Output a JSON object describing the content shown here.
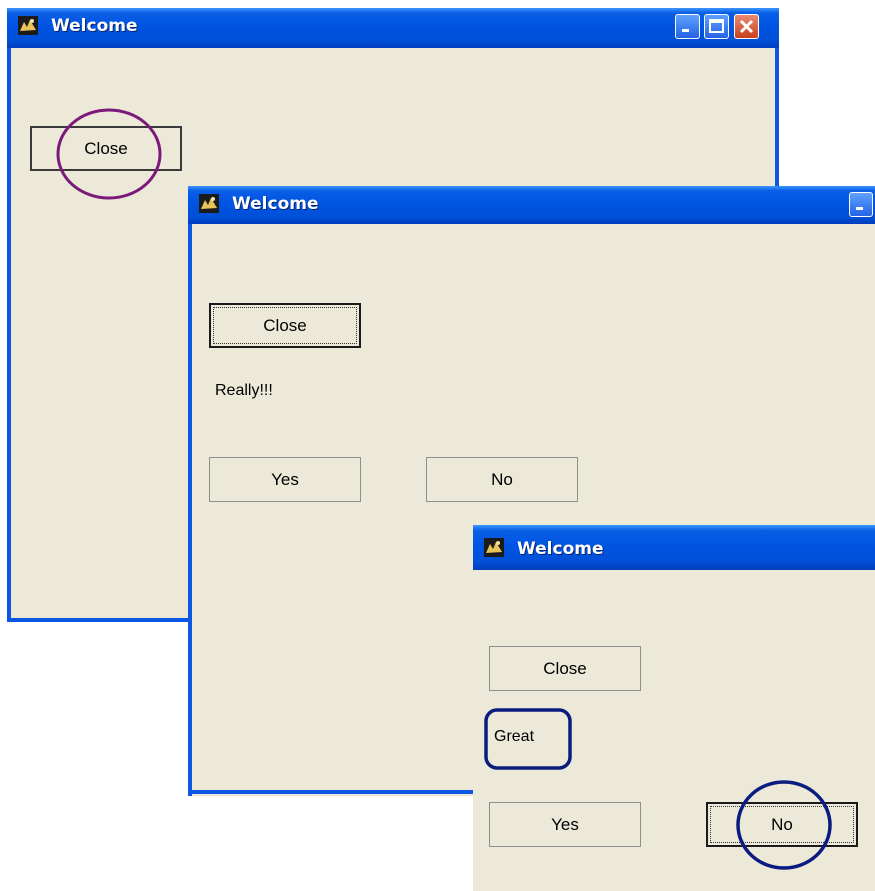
{
  "windows": [
    {
      "title": "Welcome",
      "close_button": "Close",
      "annotation_color": "#7b1a7b"
    },
    {
      "title": "Welcome",
      "close_button": "Close",
      "message": "Really!!!",
      "yes_button": "Yes",
      "no_button": "No"
    },
    {
      "title": "Welcome",
      "close_button": "Close",
      "message": "Great",
      "yes_button": "Yes",
      "no_button": "No",
      "annotation_color": "#0b1c80"
    }
  ],
  "icons": {
    "app": "app-icon",
    "minimize": "minimize-icon",
    "maximize": "maximize-icon",
    "close": "close-icon"
  }
}
